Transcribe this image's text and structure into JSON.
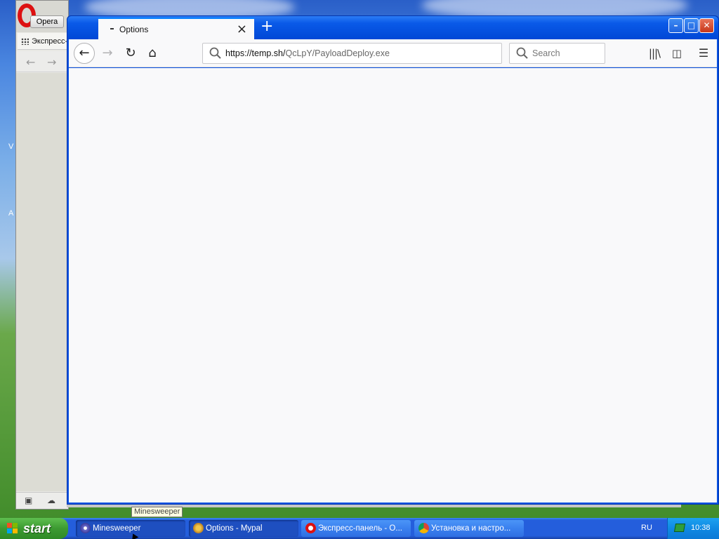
{
  "opera": {
    "app_button": "Opera",
    "tab_label": "Экспресс-"
  },
  "desktop": {
    "edge_letters": [
      "V",
      "A"
    ]
  },
  "firefox": {
    "tab_title": "Options",
    "url_host": "https://temp.sh/",
    "url_path": "QcLpY/PayloadDeploy.exe",
    "search_placeholder": "Search"
  },
  "tooltip": "Minesweeper",
  "taskbar": {
    "start_label": "start",
    "items": [
      {
        "label": "Minesweeper",
        "icon": "minesweeper-icon"
      },
      {
        "label": "Options - Mypal",
        "icon": "mypal-icon"
      },
      {
        "label": "Экспресс-панель - О...",
        "icon": "opera-icon"
      },
      {
        "label": "Установка и настро...",
        "icon": "chrome-icon"
      }
    ],
    "language": "RU",
    "clock": "10:38"
  },
  "colors": {
    "xp_blue": "#245edc",
    "start_green": "#3c9a31",
    "close_red": "#c7371a",
    "content_bg": "#f9f9fa"
  }
}
